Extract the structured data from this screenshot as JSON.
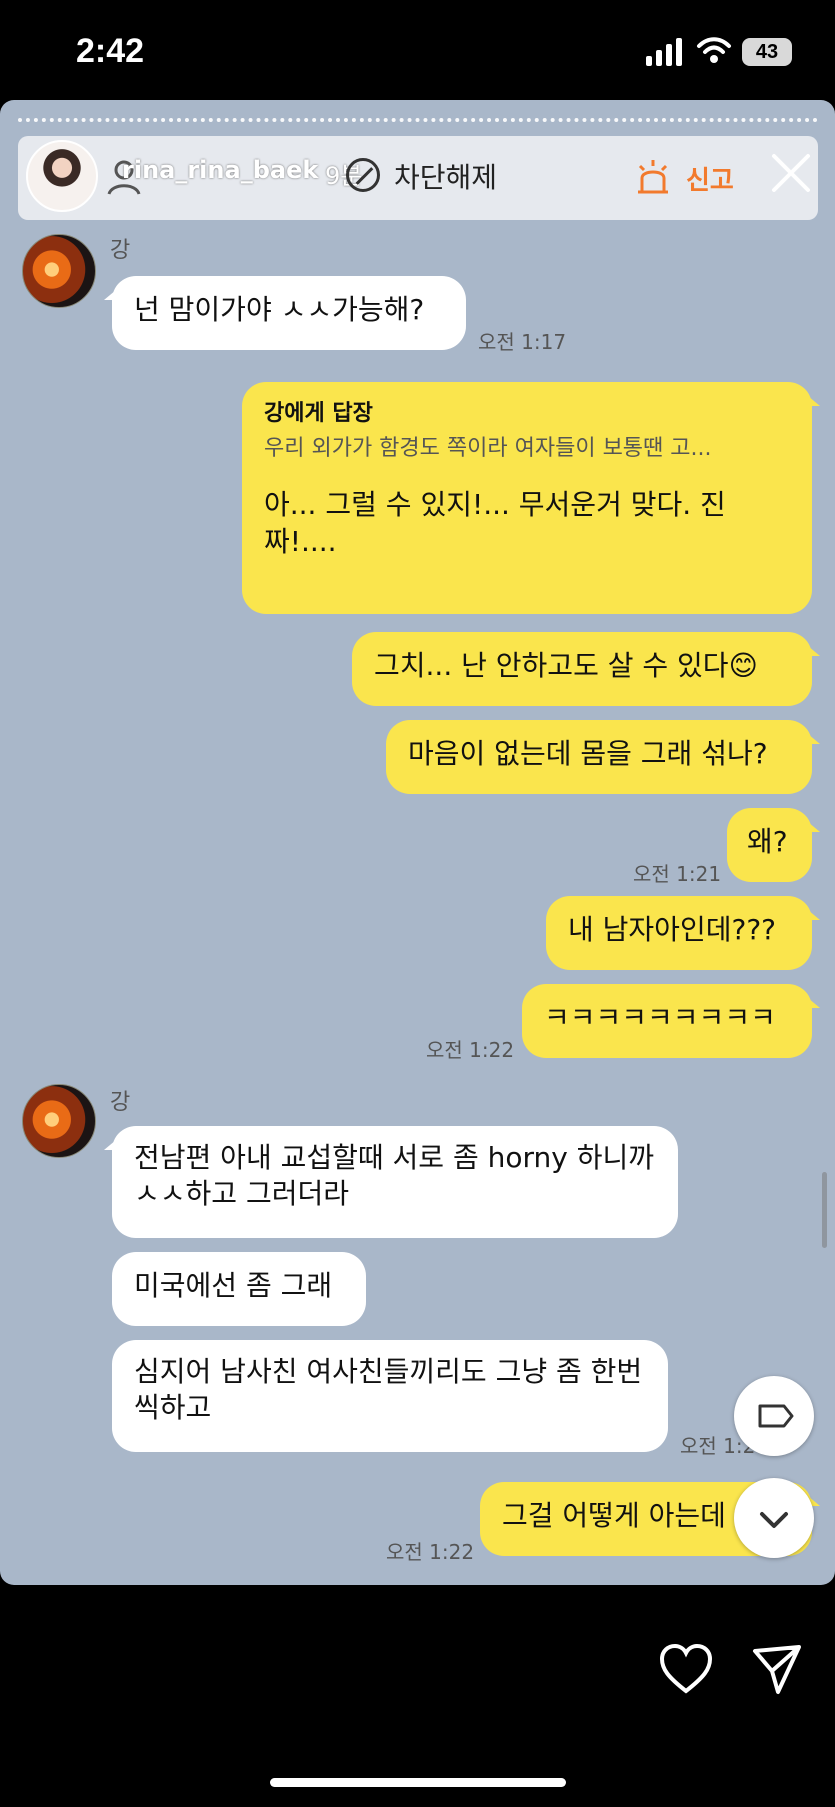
{
  "status_bar": {
    "time": "2:42",
    "battery": "43"
  },
  "story_header": {
    "username": "rina_rina_baek",
    "posted_ago": "9분",
    "unblock_label": "차단해제",
    "report_label": "신고"
  },
  "chat": [
    {
      "sender": "강",
      "messages": [
        {
          "text": "넌 맘이가야 ㅅㅅ가능해?"
        }
      ],
      "time": "오전 1:17"
    },
    {
      "sender": "me",
      "reply_to": "강에게 답장",
      "reply_preview": "우리 외가가 함경도 쪽이라 여자들이 보통땐 고...",
      "text": "아... 그럴 수 있지!... 무서운거 맞다. 진짜!...."
    },
    {
      "sender": "me",
      "text": "그치... 난 안하고도 살 수 있다😊"
    },
    {
      "sender": "me",
      "text": "마음이 없는데 몸을 그래 섞나?"
    },
    {
      "sender": "me",
      "text": "왜?",
      "time": "오전 1:21"
    },
    {
      "sender": "me",
      "text": "내 남자아인데???"
    },
    {
      "sender": "me",
      "text": "ㅋㅋㅋㅋㅋㅋㅋㅋㅋ",
      "time": "오전 1:22"
    },
    {
      "sender": "강",
      "messages": [
        {
          "text": "전남편 아내 교섭할때 서로 좀 horny 하니까 ㅅㅅ하고 그러더라"
        },
        {
          "text": "미국에선 좀 그래"
        },
        {
          "text": "심지어 남사친 여사친들끼리도 그냥 좀 한번씩하고"
        }
      ],
      "time": "오전 1:2"
    },
    {
      "sender": "me",
      "text": "그걸 어떻게 아는데",
      "time": "오전 1:22"
    }
  ],
  "icons": {
    "heart": "heart-icon",
    "send": "send-icon",
    "tag": "tag-icon",
    "down": "chevron-down-icon"
  }
}
